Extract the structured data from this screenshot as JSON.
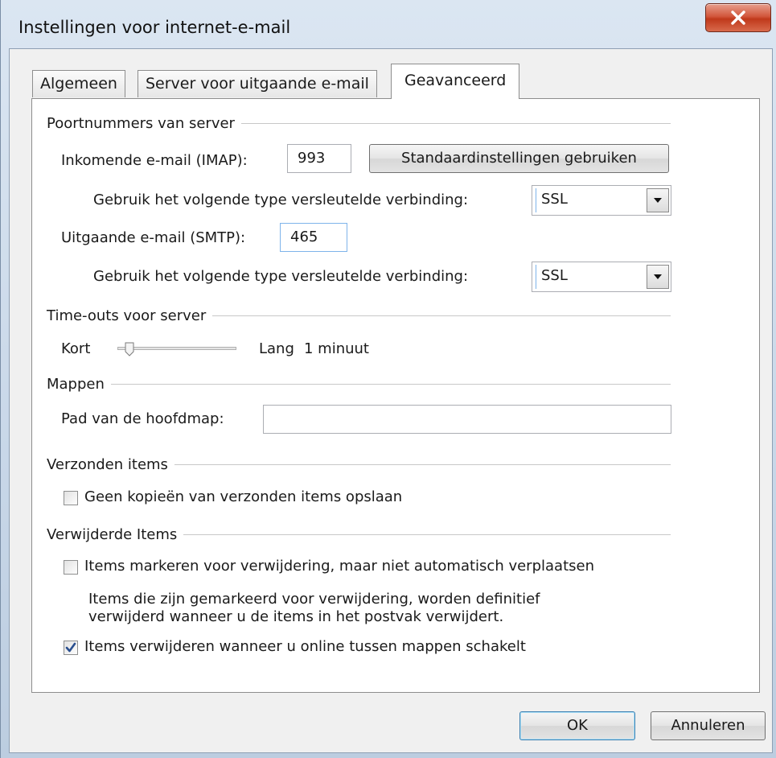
{
  "window": {
    "title": "Instellingen voor internet-e-mail",
    "close_icon": "close-icon"
  },
  "tabs": [
    {
      "label": "Algemeen",
      "active": false
    },
    {
      "label": "Server voor uitgaande e-mail",
      "active": false
    },
    {
      "label": "Geavanceerd",
      "active": true
    }
  ],
  "ports": {
    "group_label": "Poortnummers van server",
    "incoming_label": "Inkomende e-mail (IMAP):",
    "incoming_value": "993",
    "defaults_button": "Standaardinstellingen gebruiken",
    "incoming_encryption_label": "Gebruik het volgende type versleutelde verbinding:",
    "incoming_encryption_value": "SSL",
    "outgoing_label": "Uitgaande e-mail (SMTP):",
    "outgoing_value": "465",
    "outgoing_encryption_label": "Gebruik het volgende type versleutelde verbinding:",
    "outgoing_encryption_value": "SSL"
  },
  "timeouts": {
    "group_label": "Time-outs voor server",
    "short_label": "Kort",
    "long_label": "Lang",
    "value_text": "1 minuut",
    "slider_position": 0.1
  },
  "folders": {
    "group_label": "Mappen",
    "root_path_label": "Pad van de hoofdmap:",
    "root_path_value": ""
  },
  "sent": {
    "group_label": "Verzonden items",
    "no_copies_label": "Geen kopieën van verzonden items opslaan",
    "no_copies_checked": false
  },
  "deleted": {
    "group_label": "Verwijderde Items",
    "mark_label": "Items markeren voor verwijdering, maar niet automatisch verplaatsen",
    "mark_checked": false,
    "info_line1": "Items die zijn gemarkeerd voor verwijdering, worden definitief",
    "info_line2": "verwijderd wanneer u de items in het postvak verwijdert.",
    "purge_label": "Items verwijderen wanneer u online tussen mappen schakelt",
    "purge_checked": true
  },
  "buttons": {
    "ok": "OK",
    "cancel": "Annuleren"
  },
  "colors": {
    "close_button": "#c7401f",
    "focus_border": "#7eb4ea",
    "checkmark": "#2a4f8f"
  }
}
